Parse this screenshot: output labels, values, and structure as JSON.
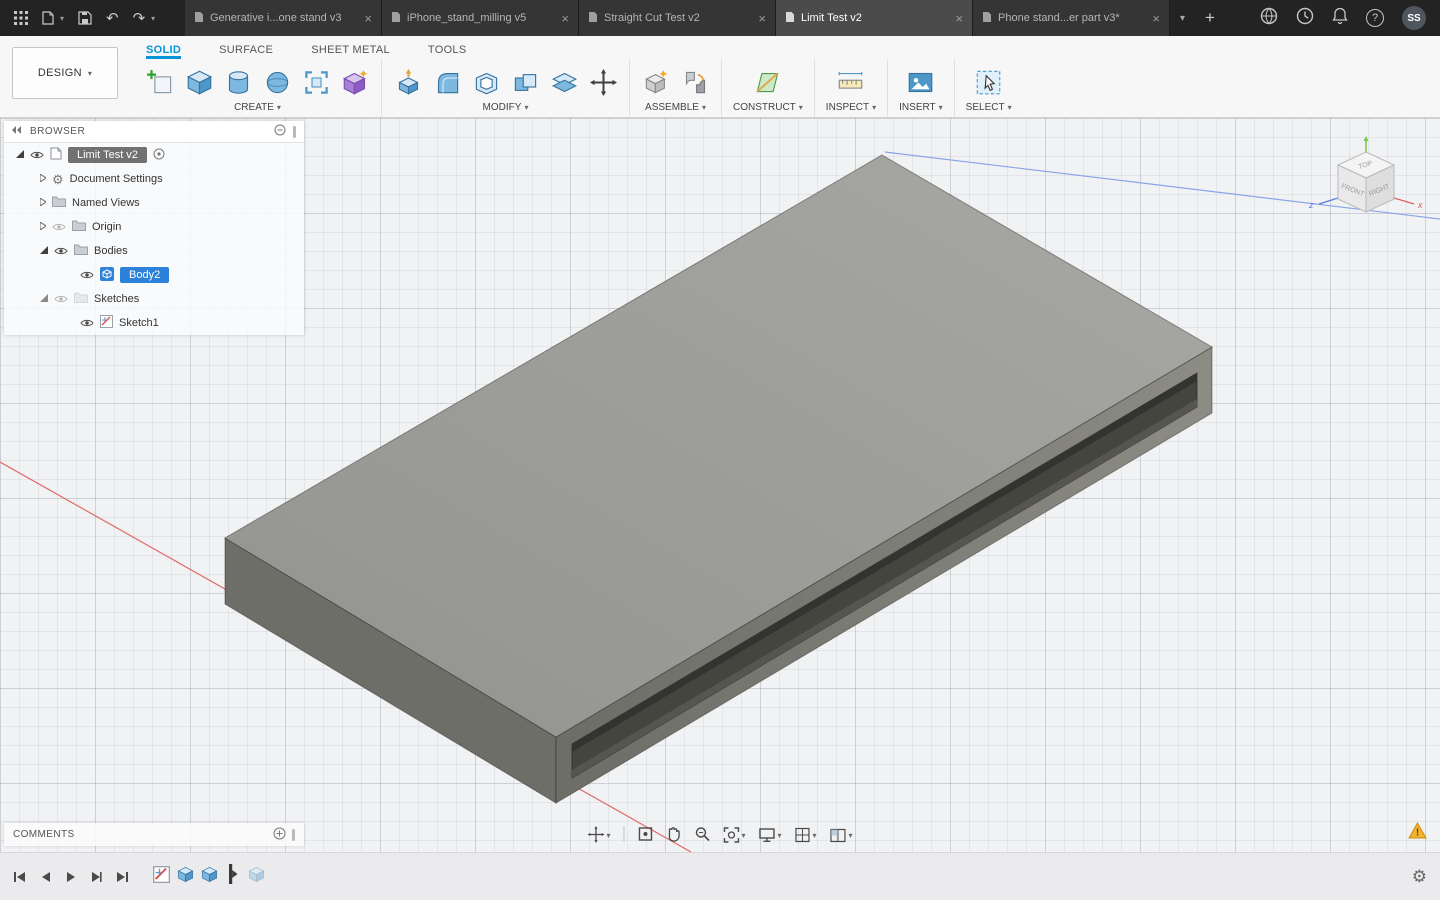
{
  "icons": {
    "caret_down": "▾",
    "close": "×",
    "plus": "+",
    "undo": "↶",
    "redo": "↷",
    "gear": "⚙",
    "question": "?",
    "warning": "!"
  },
  "topbar": {
    "document_tabs": [
      {
        "label": "Generative i...one stand v3",
        "active": false
      },
      {
        "label": "iPhone_stand_milling v5",
        "active": false
      },
      {
        "label": "Straight Cut Test v2",
        "active": false
      },
      {
        "label": "Limit Test v2",
        "active": true
      },
      {
        "label": "Phone stand...er part v3*",
        "active": false
      }
    ],
    "avatar_initials": "SS"
  },
  "ribbon": {
    "design_button": "DESIGN",
    "tabs": [
      {
        "label": "SOLID",
        "active": true
      },
      {
        "label": "SURFACE",
        "active": false
      },
      {
        "label": "SHEET METAL",
        "active": false
      },
      {
        "label": "TOOLS",
        "active": false
      }
    ],
    "groups": [
      {
        "label": "CREATE"
      },
      {
        "label": "MODIFY"
      },
      {
        "label": "ASSEMBLE"
      },
      {
        "label": "CONSTRUCT"
      },
      {
        "label": "INSPECT"
      },
      {
        "label": "INSERT"
      },
      {
        "label": "SELECT"
      }
    ]
  },
  "browser": {
    "title": "BROWSER",
    "items": [
      {
        "label": "Limit Test v2",
        "selected": true
      },
      {
        "label": "Document Settings"
      },
      {
        "label": "Named Views"
      },
      {
        "label": "Origin",
        "hidden": true
      },
      {
        "label": "Bodies"
      },
      {
        "label": "Body2",
        "selected": true
      },
      {
        "label": "Sketches",
        "hidden": true
      },
      {
        "label": "Sketch1"
      }
    ]
  },
  "viewcube": {
    "top": "TOP",
    "front": "FRONT",
    "right": "RIGHT",
    "axis_x": "x",
    "axis_z": "z"
  },
  "comments": {
    "title": "COMMENTS"
  },
  "colors": {
    "accent_blue": "#0696d7",
    "selection_blue": "#2e81d8",
    "topbar_bg": "#232323",
    "model_top": "#9d9d9a",
    "model_left": "#6e6e69",
    "model_front": "#7d7d77",
    "slot_dark": "#45453f",
    "axis_red": "#e06a6a",
    "axis_blue": "#8aa4e8",
    "warning_yellow": "#f2b32c"
  }
}
